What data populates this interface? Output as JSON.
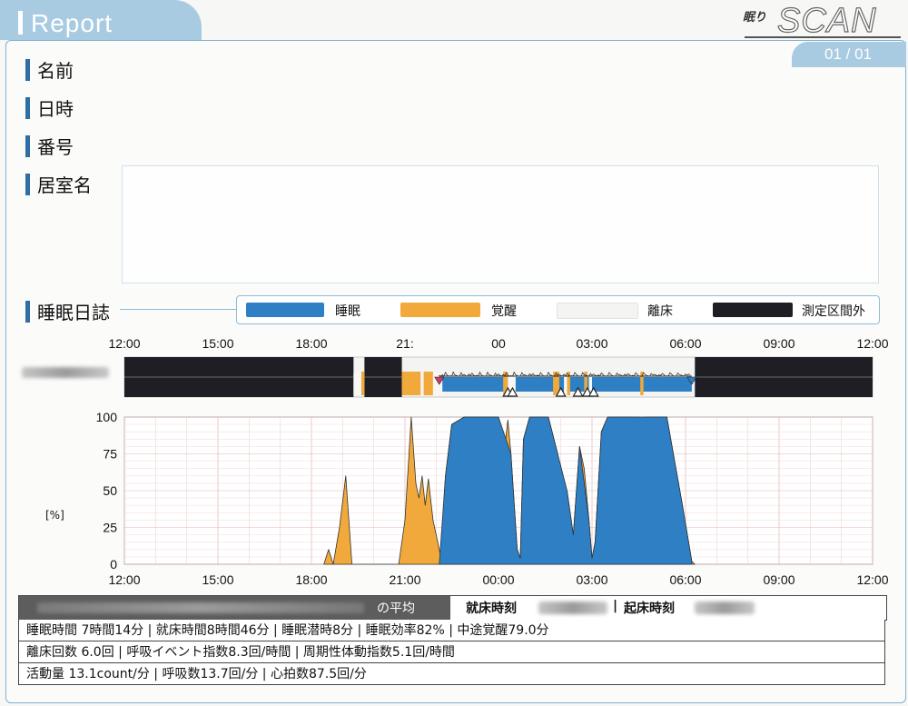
{
  "header": {
    "title": "Report",
    "logo_small": "眠り",
    "logo_big": "SCAN",
    "page": "01 / 01"
  },
  "fields": {
    "name": "名前",
    "datetime": "日時",
    "number": "番号",
    "room": "居室名"
  },
  "diary": {
    "title": "睡眠日誌",
    "legend": [
      {
        "label": "睡眠",
        "color": "#2e7fc4"
      },
      {
        "label": "覚醒",
        "color": "#f2a93b"
      },
      {
        "label": "離床",
        "color": "#f4f4f2"
      },
      {
        "label": "測定区間外",
        "color": "#1e1e24"
      }
    ],
    "time_labels_top": [
      "12:00",
      "15:00",
      "18:00",
      "21:",
      "00",
      "03:00",
      "06:00",
      "09:00",
      "12:00"
    ],
    "time_labels_bottom": [
      "12:00",
      "15:00",
      "18:00",
      "21:00",
      "00:00",
      "03:00",
      "06:00",
      "09:00",
      "12:00"
    ]
  },
  "chart_data": {
    "type": "area",
    "ylabel": "[%]",
    "ylim": [
      0,
      100
    ],
    "yticks": [
      0,
      25,
      50,
      75,
      100
    ],
    "x_unit": "hours from 12:00",
    "series": [
      {
        "name": "睡眠",
        "color": "#2e7fc4",
        "points": [
          [
            10.1,
            0
          ],
          [
            10.3,
            60
          ],
          [
            10.5,
            95
          ],
          [
            10.9,
            100
          ],
          [
            11.5,
            100
          ],
          [
            12.0,
            100
          ],
          [
            12.4,
            75
          ],
          [
            12.6,
            10
          ],
          [
            12.7,
            4
          ],
          [
            12.8,
            85
          ],
          [
            13.0,
            100
          ],
          [
            13.6,
            100
          ],
          [
            14.2,
            50
          ],
          [
            14.4,
            20
          ],
          [
            14.6,
            80
          ],
          [
            14.9,
            30
          ],
          [
            15.0,
            4
          ],
          [
            15.1,
            15
          ],
          [
            15.3,
            90
          ],
          [
            15.5,
            100
          ],
          [
            16.5,
            100
          ],
          [
            17.4,
            100
          ],
          [
            17.9,
            40
          ],
          [
            18.2,
            2
          ]
        ]
      },
      {
        "name": "覚醒",
        "color": "#f2a93b",
        "points": [
          [
            6.4,
            0
          ],
          [
            6.55,
            10
          ],
          [
            6.7,
            0
          ],
          [
            6.9,
            25
          ],
          [
            7.1,
            60
          ],
          [
            7.3,
            0
          ],
          [
            8.8,
            0
          ],
          [
            9.0,
            30
          ],
          [
            9.2,
            100
          ],
          [
            9.35,
            55
          ],
          [
            9.45,
            45
          ],
          [
            9.55,
            60
          ],
          [
            9.65,
            40
          ],
          [
            9.75,
            58
          ],
          [
            9.9,
            30
          ],
          [
            10.05,
            15
          ],
          [
            10.15,
            5
          ],
          [
            10.3,
            60
          ],
          [
            10.5,
            95
          ],
          [
            10.9,
            100
          ],
          [
            12.0,
            100
          ],
          [
            12.1,
            60
          ],
          [
            12.3,
            98
          ],
          [
            12.4,
            75
          ],
          [
            12.6,
            10
          ],
          [
            12.7,
            4
          ],
          [
            12.8,
            85
          ],
          [
            13.0,
            100
          ],
          [
            13.6,
            100
          ],
          [
            13.9,
            75
          ],
          [
            14.0,
            55
          ],
          [
            14.2,
            50
          ],
          [
            14.4,
            20
          ],
          [
            14.6,
            80
          ],
          [
            14.75,
            65
          ],
          [
            14.9,
            30
          ],
          [
            15.0,
            4
          ],
          [
            15.1,
            15
          ],
          [
            15.3,
            90
          ],
          [
            15.5,
            100
          ],
          [
            16.5,
            100
          ],
          [
            16.6,
            93
          ],
          [
            16.7,
            100
          ],
          [
            17.4,
            100
          ],
          [
            17.9,
            40
          ],
          [
            18.2,
            2
          ],
          [
            18.3,
            0
          ]
        ]
      }
    ],
    "timeline": {
      "wake_segments": [
        [
          7.6,
          7.7
        ],
        [
          8.9,
          9.5
        ],
        [
          9.6,
          9.9
        ],
        [
          12.15,
          12.3
        ],
        [
          13.75,
          13.95
        ],
        [
          14.2,
          14.3
        ],
        [
          14.75,
          14.85
        ],
        [
          16.55,
          16.65
        ]
      ],
      "absent_segments": [
        [
          7.35,
          7.58
        ],
        [
          9.9,
          10.2
        ],
        [
          12.3,
          12.55
        ],
        [
          14.1,
          14.2
        ],
        [
          14.9,
          15.0
        ]
      ],
      "outside_segments": [
        [
          0,
          7.35
        ],
        [
          7.7,
          8.9
        ],
        [
          18.3,
          24
        ]
      ],
      "markers_up": [
        12.3,
        12.45,
        14.0,
        14.55,
        14.85,
        15.05
      ],
      "marker_in": 10.1,
      "marker_out": 18.2
    }
  },
  "stats": {
    "avg_label": "の平均",
    "bedtime_label": "就床時刻",
    "wake_label": "起床時刻",
    "row1": "睡眠時間 7時間14分 | 就床時間8時間46分 | 睡眠潜時8分 | 睡眠効率82% | 中途覚醒79.0分",
    "row2": "離床回数 6.0回 | 呼吸イベント指数8.3回/時間 | 周期性体動指数5.1回/時間",
    "row3": "活動量 13.1count/分 | 呼吸数13.7回/分 | 心拍数87.5回/分"
  }
}
